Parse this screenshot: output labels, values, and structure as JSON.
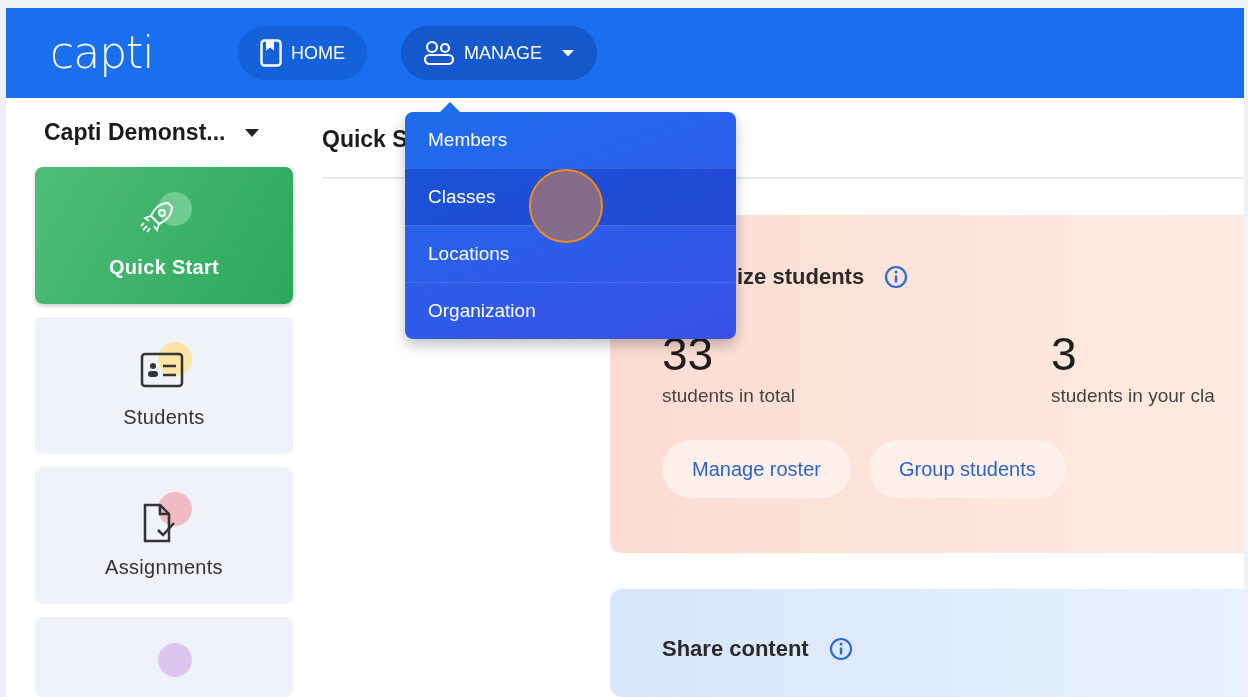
{
  "header": {
    "logo": "capti",
    "nav": [
      {
        "label": "HOME",
        "kind": "link"
      },
      {
        "label": "MANAGE",
        "kind": "dropdown",
        "expanded": true,
        "menu": [
          {
            "label": "Members",
            "selected": false
          },
          {
            "label": "Classes",
            "selected": true
          },
          {
            "label": "Locations",
            "selected": false
          },
          {
            "label": "Organization",
            "selected": false
          }
        ]
      }
    ]
  },
  "sidebar": {
    "organization": "Capti Demonst...",
    "items": [
      {
        "label": "Quick Start",
        "kind": "rocket",
        "selected": true,
        "color": "#6fcb8f"
      },
      {
        "label": "Students",
        "kind": "id-card",
        "selected": false,
        "color": "#fde3a5"
      },
      {
        "label": "Assignments",
        "kind": "document",
        "selected": false,
        "color": "#efbcc5"
      },
      {
        "kind": "partial",
        "selected": false,
        "color": "#dcc6f0"
      }
    ]
  },
  "main": {
    "heading": "Quick S",
    "cards": [
      {
        "kind": "stats",
        "title": "ize students",
        "stats": [
          {
            "value": "33",
            "label": "students in total"
          },
          {
            "value": "3",
            "label": "students in your cla"
          }
        ],
        "buttons": [
          "Manage roster",
          "Group students"
        ]
      },
      {
        "kind": "share",
        "title": "Share content"
      }
    ]
  }
}
